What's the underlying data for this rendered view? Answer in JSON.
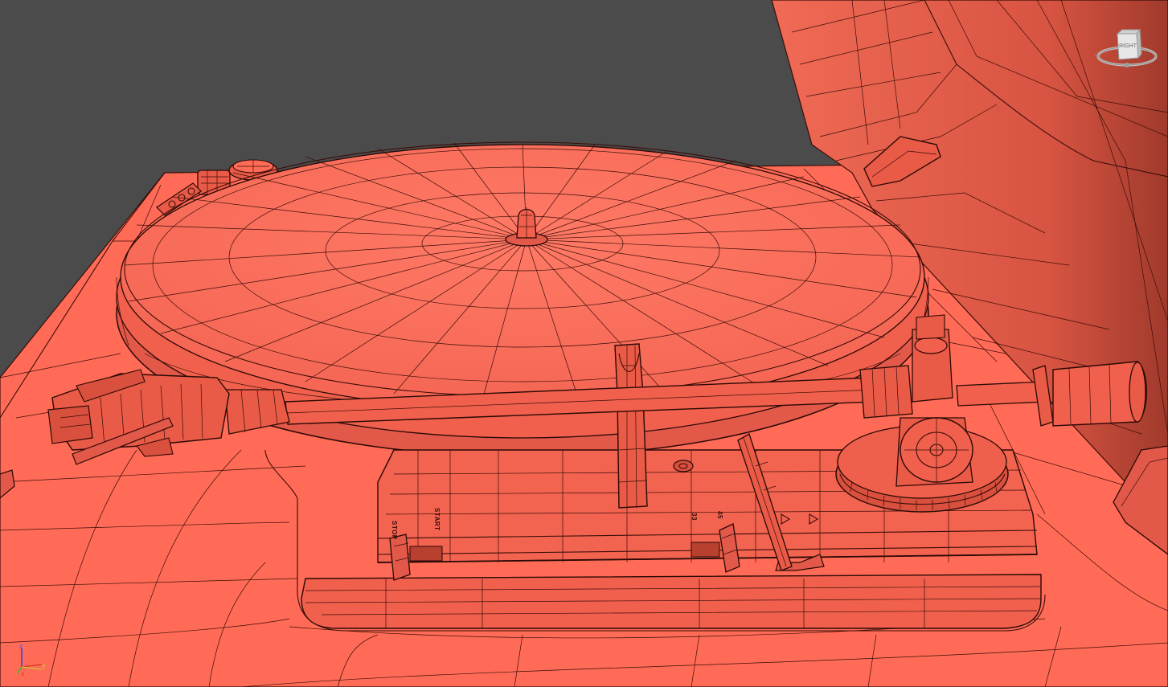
{
  "viewport": {
    "view_label": "RIGHT",
    "background": "#4b4b4b",
    "model_color": "#ff6a55",
    "wire_color": "#3a0d08"
  },
  "axes": {
    "x": "x",
    "y": "y",
    "z": "z"
  },
  "turntable_labels": {
    "stop": "STOP",
    "start": "START",
    "speed_33": "33",
    "speed_45": "45"
  },
  "icons": [
    "viewcube-icon",
    "axis-tripod-icon"
  ]
}
